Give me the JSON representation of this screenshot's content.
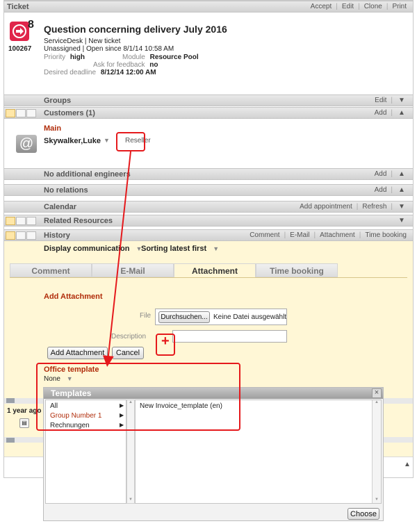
{
  "ticket": {
    "header_title": "Ticket",
    "header_actions": [
      "Accept",
      "Edit",
      "Clone",
      "Print"
    ],
    "id": "100267",
    "title": "Question concerning delivery July 2016",
    "subtitle": "ServiceDesk | New ticket",
    "status_line": "Unassigned | Open since 8/1/14 10:58 AM",
    "priority_label": "Priority",
    "priority_value": "high",
    "module_label": "Module",
    "module_value": "Resource Pool",
    "feedback_label": "Ask for feedback",
    "feedback_value": "no",
    "deadline_label": "Desired deadline",
    "deadline_value": "8/12/14 12:00 AM"
  },
  "groups": {
    "title": "Groups",
    "action": "Edit"
  },
  "customers": {
    "title": "Customers (1)",
    "action": "Add",
    "section": "Main",
    "name": "Skywalker,Luke",
    "role": "Reseller"
  },
  "engineers": {
    "title": "No additional engineers",
    "action": "Add"
  },
  "relations": {
    "title": "No relations",
    "action": "Add"
  },
  "calendar": {
    "title": "Calendar",
    "actions": [
      "Add appointment",
      "Refresh"
    ]
  },
  "related": {
    "title": "Related Resources"
  },
  "history": {
    "title": "History",
    "actions": [
      "Comment",
      "E-Mail",
      "Attachment",
      "Time booking"
    ],
    "display_filter": "Display communication",
    "sort_filter": "Sorting latest first",
    "tabs": [
      "Comment",
      "E-Mail",
      "Attachment",
      "Time booking"
    ],
    "active_tab": "Attachment"
  },
  "attachment": {
    "title": "Add Attachment",
    "file_label": "File",
    "browse_button": "Durchsuchen...",
    "no_file_text": "Keine Datei ausgewählt",
    "description_label": "Description",
    "description_value": "",
    "add_button": "Add Attachment",
    "cancel_button": "Cancel",
    "plus_badge": "+"
  },
  "office_template": {
    "title": "Office template",
    "value": "None"
  },
  "timeline": {
    "label": "1 year ago"
  },
  "templates_dialog": {
    "title": "Templates",
    "close_glyph": "×",
    "folders": [
      "All",
      "Group Number 1",
      "Rechnungen"
    ],
    "selected_folder": "Group Number 1",
    "files": [
      "New Invoice_template (en)"
    ],
    "choose_button": "Choose"
  },
  "colors": {
    "accent_red": "#b02c0a",
    "callout_red": "#e5191c",
    "history_bg": "#fff7d6",
    "ticket_icon": "#e0254a"
  },
  "icons": [
    "ticket-icon",
    "at-sign-icon",
    "chevron-down-icon",
    "chevron-up-icon",
    "close-icon",
    "comment-icon",
    "triangle-right-icon"
  ]
}
